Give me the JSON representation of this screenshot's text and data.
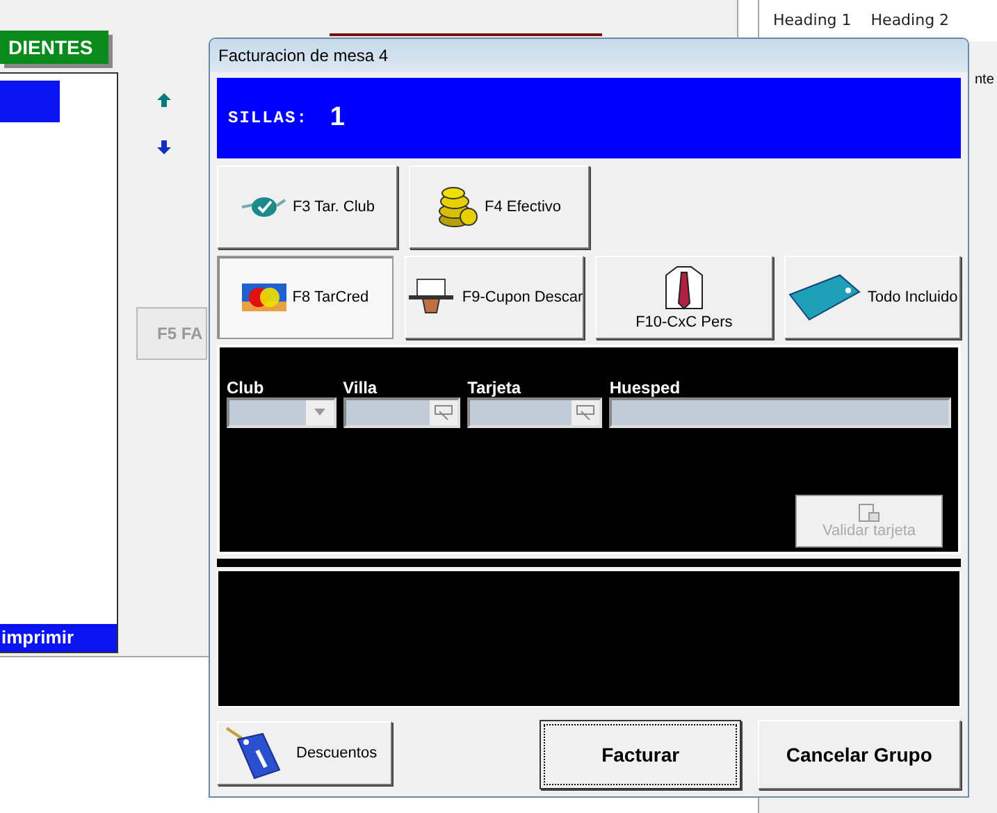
{
  "background": {
    "green_header": "DIENTES",
    "list_footer": "imprimir",
    "side_button": "F5 FA",
    "tabs": [
      "Heading 1",
      "Heading 2"
    ],
    "side_fragment": "nte"
  },
  "window": {
    "title": "Facturacion de mesa 4"
  },
  "banner": {
    "label": "SILLAS:",
    "value": "1"
  },
  "payment_buttons": [
    {
      "label": "F3 Tar. Club",
      "selected": false
    },
    {
      "label": "F4  Efectivo",
      "selected": false
    },
    {
      "label": "F8 TarCred",
      "selected": true
    },
    {
      "label": "F9-Cupon Descar",
      "selected": false
    },
    {
      "label": "F10-CxC Pers",
      "selected": false
    },
    {
      "label": "Todo Incluido",
      "selected": false
    }
  ],
  "fields": [
    {
      "label": "Club",
      "kind": "dropdown"
    },
    {
      "label": "Villa",
      "kind": "lookup"
    },
    {
      "label": "Tarjeta",
      "kind": "lookup"
    },
    {
      "label": "Huesped",
      "kind": "text"
    }
  ],
  "validate_button": {
    "label": "Validar tarjeta",
    "disabled": true
  },
  "bottom_buttons": {
    "discounts": "Descuentos",
    "invoice": "Facturar",
    "cancel": "Cancelar Grupo"
  }
}
